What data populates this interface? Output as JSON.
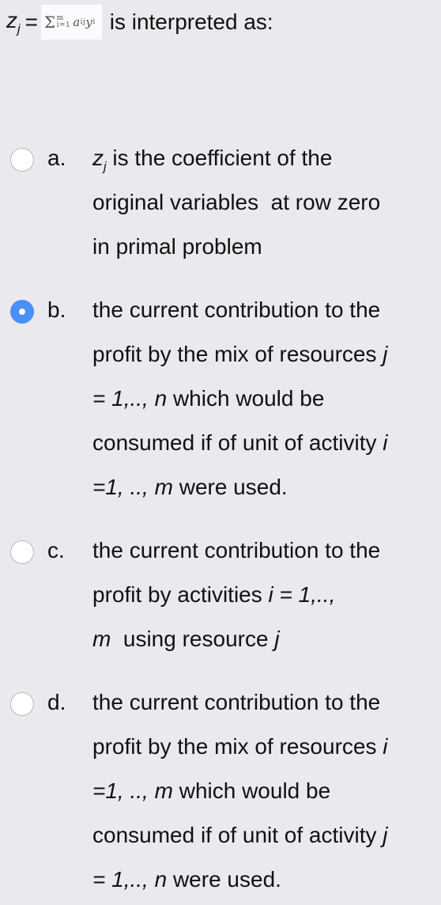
{
  "question": {
    "lhs": "z",
    "lhs_sub": "j",
    "equals": "=",
    "formula": {
      "sigma": "Σ",
      "upper": "m",
      "lower": "i=1",
      "term_a": "a",
      "term_a_sub": "ij",
      "term_y": "y",
      "term_y_sub": "i"
    },
    "text": "is interpreted as:"
  },
  "options": [
    {
      "letter": "a.",
      "selected": false,
      "lines": [
        {
          "var": "z",
          "var_sub": "j",
          "text": " is the coefficient of the"
        },
        {
          "text": "original variables  at row zero"
        },
        {
          "text": "in primal problem"
        }
      ]
    },
    {
      "letter": "b.",
      "selected": true,
      "lines": [
        {
          "text": "the current contribution to the"
        },
        {
          "text": "profit by the mix of resources ",
          "it": "j"
        },
        {
          "it": "= 1,.., n",
          "text": " which would be"
        },
        {
          "text": "consumed if of unit of activity ",
          "it": "i"
        },
        {
          "it": "=1, .., m",
          "text": " were used."
        }
      ]
    },
    {
      "letter": "c.",
      "selected": false,
      "lines": [
        {
          "text": "the current contribution to the"
        },
        {
          "text": "profit by activities ",
          "it": "i = 1,..,"
        },
        {
          "it": "m",
          "text": "  using resource ",
          "it2": "j"
        }
      ]
    },
    {
      "letter": "d.",
      "selected": false,
      "lines": [
        {
          "text": "the current contribution to the"
        },
        {
          "text": "profit by the mix of resources ",
          "it": "i"
        },
        {
          "it": "=1, .., m",
          "text": " which would be"
        },
        {
          "text": "consumed if of unit of activity ",
          "it": "j"
        },
        {
          "it": "= 1,.., n",
          "text": " were used."
        }
      ]
    }
  ],
  "colors": {
    "background": "#e9e9ee",
    "radio_selected": "#4a8ef7",
    "radio_border": "#b8b8bd"
  }
}
